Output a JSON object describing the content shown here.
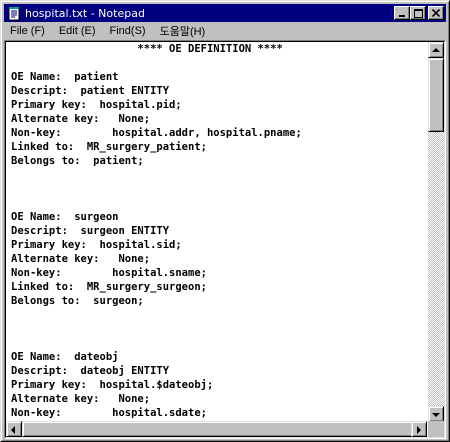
{
  "window": {
    "title": "hospital.txt - Notepad",
    "icons": {
      "app": "notepad-icon",
      "minimize": "minimize-icon",
      "maximize": "maximize-icon",
      "close": "close-icon",
      "scroll_up": "arrow-up-icon",
      "scroll_down": "arrow-down-icon",
      "scroll_left": "arrow-left-icon",
      "scroll_right": "arrow-right-icon"
    },
    "colors": {
      "titlebar": "#000080",
      "chrome": "#c0c0c0",
      "editor_bg": "#ffffff"
    }
  },
  "menu": [
    {
      "label": "File (F)"
    },
    {
      "label": "Edit (E)"
    },
    {
      "label": "Find(S)"
    },
    {
      "label": "도움말(H)"
    }
  ],
  "document": {
    "lines": [
      "                    **** OE DEFINITION ****",
      "",
      "OE Name:  patient",
      "Descript:  patient ENTITY",
      "Primary key:  hospital.pid;",
      "Alternate key:   None;",
      "Non-key:        hospital.addr, hospital.pname;",
      "Linked to:  MR_surgery_patient;",
      "Belongs to:  patient;",
      "",
      "",
      "",
      "OE Name:  surgeon",
      "Descript:  surgeon ENTITY",
      "Primary key:  hospital.sid;",
      "Alternate key:   None;",
      "Non-key:        hospital.sname;",
      "Linked to:  MR_surgery_surgeon;",
      "Belongs to:  surgeon;",
      "",
      "",
      "",
      "OE Name:  dateobj",
      "Descript:  dateobj ENTITY",
      "Primary key:  hospital.$dateobj;",
      "Alternate key:   None;",
      "Non-key:        hospital.sdate;"
    ]
  }
}
